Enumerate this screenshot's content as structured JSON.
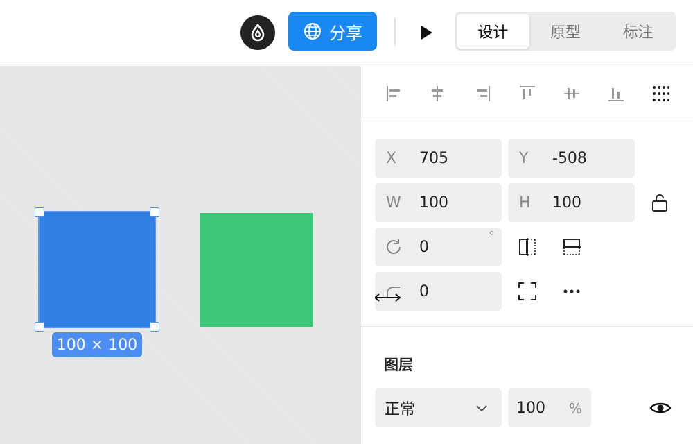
{
  "header": {
    "share_label": "分享",
    "tabs": [
      {
        "label": "设计",
        "active": true
      },
      {
        "label": "原型",
        "active": false
      },
      {
        "label": "标注",
        "active": false
      }
    ]
  },
  "canvas": {
    "selection_size": "100 × 100",
    "shapes": [
      {
        "name": "blue-rect",
        "color": "#2f80e2"
      },
      {
        "name": "green-rect",
        "color": "#3cc878"
      }
    ]
  },
  "panel": {
    "align_icons": [
      "align-left-icon",
      "align-center-h-icon",
      "align-right-icon",
      "align-top-icon",
      "align-middle-v-icon",
      "align-bottom-icon",
      "more-grid-icon"
    ],
    "x": {
      "label": "X",
      "value": "705"
    },
    "y": {
      "label": "Y",
      "value": "-508"
    },
    "w": {
      "label": "W",
      "value": "100"
    },
    "h": {
      "label": "H",
      "value": "100"
    },
    "rotation": {
      "value": "0",
      "unit": "°"
    },
    "radius": {
      "value": "0"
    },
    "layer": {
      "title": "图层",
      "blend_mode": "正常",
      "opacity": "100",
      "opacity_unit": "%"
    }
  },
  "colors": {
    "accent": "#1a88f2",
    "selection": "#4d8ef5"
  }
}
